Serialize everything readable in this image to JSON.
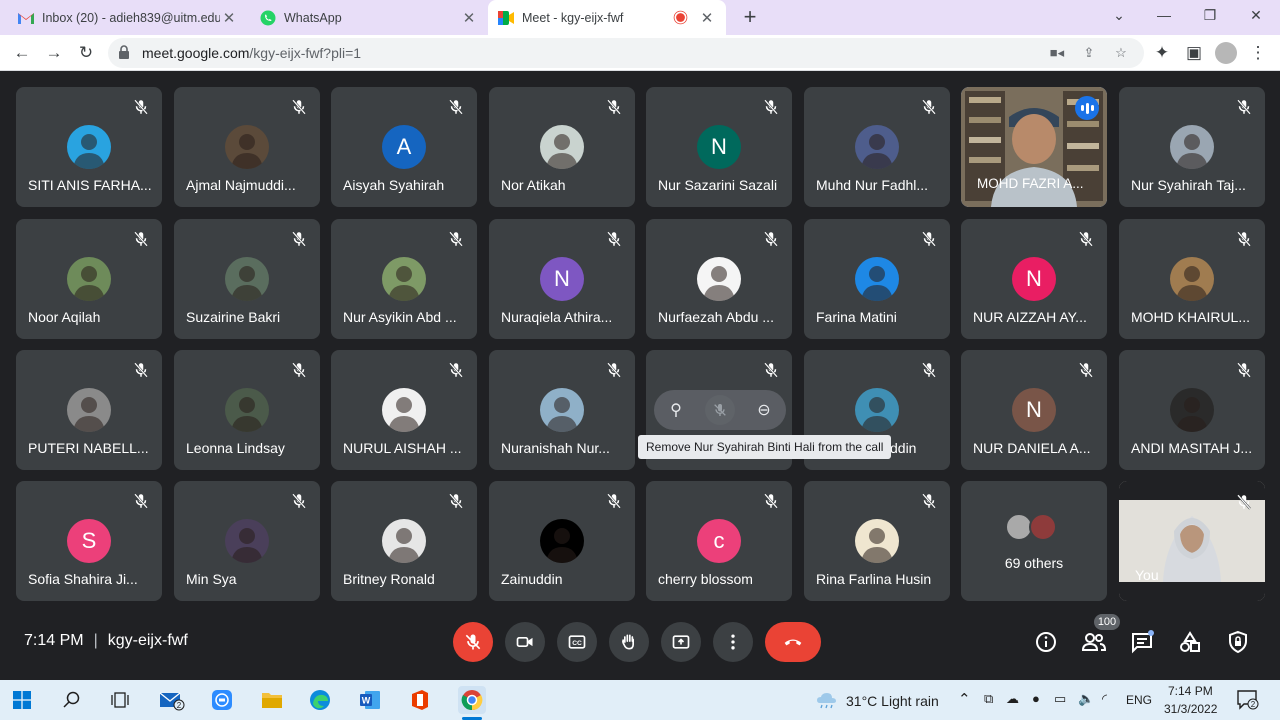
{
  "browser": {
    "tabs": [
      {
        "title": "Inbox (20) - adieh839@uitm.edu.",
        "icon": "gmail-icon"
      },
      {
        "title": "WhatsApp",
        "icon": "whatsapp-icon"
      },
      {
        "title": "Meet - kgy-eijx-fwf",
        "icon": "meet-icon",
        "active": true
      }
    ],
    "url_host": "meet.google.com",
    "url_path": "/kgy-eijx-fwf?pli=1"
  },
  "participants": [
    {
      "name": "SITI ANIS FARHA...",
      "avatar": "photo",
      "color": "#29a3e0"
    },
    {
      "name": "Ajmal Najmuddi...",
      "avatar": "photo",
      "color": "#5b4a3a"
    },
    {
      "name": "Aisyah Syahirah",
      "avatar": "A",
      "color": "#1565c0"
    },
    {
      "name": "Nor Atikah",
      "avatar": "photo",
      "color": "#c9d3cf"
    },
    {
      "name": "Nur Sazarini Sazali",
      "avatar": "N",
      "color": "#00695c"
    },
    {
      "name": "Muhd Nur Fadhl...",
      "avatar": "photo",
      "color": "#4e5d8c"
    },
    {
      "name": "MOHD FAZRI A...",
      "avatar": "video",
      "color": "#6b6356"
    },
    {
      "name": "Nur Syahirah Taj...",
      "avatar": "photo",
      "color": "#9aa6b2"
    },
    {
      "name": "Noor Aqilah",
      "avatar": "photo",
      "color": "#6e8b5a"
    },
    {
      "name": "Suzairine Bakri",
      "avatar": "photo",
      "color": "#5a6d5e"
    },
    {
      "name": "Nur Asyikin Abd ...",
      "avatar": "photo",
      "color": "#7e9a66"
    },
    {
      "name": "Nuraqiela Athira...",
      "avatar": "N",
      "color": "#7e57c2"
    },
    {
      "name": "Nurfaezah Abdu ...",
      "avatar": "photo",
      "color": "#f5f5f5"
    },
    {
      "name": "Farina Matini",
      "avatar": "photo",
      "color": "#1e88e5"
    },
    {
      "name": "NUR AIZZAH AY...",
      "avatar": "N",
      "color": "#e91e63"
    },
    {
      "name": "MOHD KHAIRUL...",
      "avatar": "photo",
      "color": "#a07c50"
    },
    {
      "name": "PUTERI NABELL...",
      "avatar": "photo",
      "color": "#8a8a8a"
    },
    {
      "name": "Leonna Lindsay",
      "avatar": "photo",
      "color": "#4b5a4a"
    },
    {
      "name": "NURUL AISHAH ...",
      "avatar": "photo",
      "color": "#f0f0f0"
    },
    {
      "name": "Nuranishah Nur...",
      "avatar": "photo",
      "color": "#8fb0c8"
    },
    {
      "name": "",
      "avatar": "hovered",
      "color": "#3c4043"
    },
    {
      "name": "ddin",
      "avatar": "photo",
      "color": "#3f8fb4"
    },
    {
      "name": "NUR DANIELA A...",
      "avatar": "N",
      "color": "#795548"
    },
    {
      "name": "ANDI MASITAH J...",
      "avatar": "photo",
      "color": "#2a2a2a"
    },
    {
      "name": "Sofia Shahira Ji...",
      "avatar": "S",
      "color": "#ec407a"
    },
    {
      "name": "Min Sya",
      "avatar": "photo",
      "color": "#4a3f5a"
    },
    {
      "name": "Britney Ronald",
      "avatar": "photo",
      "color": "#e6e6e6"
    },
    {
      "name": "Zainuddin",
      "avatar": "photo",
      "color": "#000000"
    },
    {
      "name": "cherry blossom",
      "avatar": "c",
      "color": "#ec407a"
    },
    {
      "name": "Rina Farlina Husin",
      "avatar": "photo",
      "color": "#efe6d0"
    }
  ],
  "others_label": "69 others",
  "self_label": "You",
  "hover_tooltip": "Remove Nur Syahirah Binti Hali from the call",
  "meeting": {
    "time": "7:14 PM",
    "code": "kgy-eijx-fwf",
    "participant_count": "100"
  },
  "taskbar": {
    "weather": "31°C  Light rain",
    "lang": "ENG",
    "time": "7:14 PM",
    "date": "31/3/2022",
    "mail_badge": "2",
    "notif_badge": "2"
  }
}
